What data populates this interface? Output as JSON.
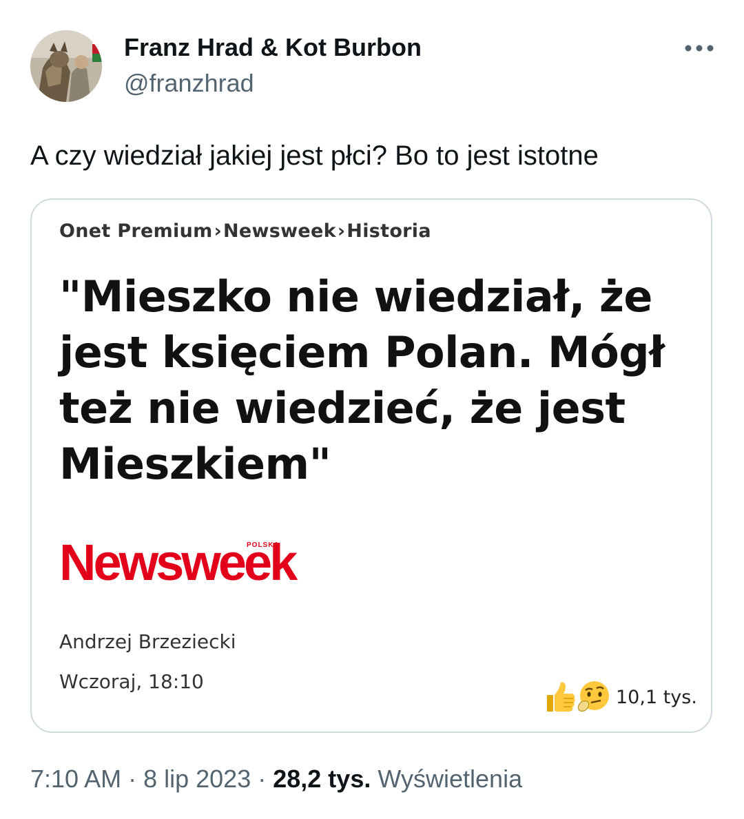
{
  "author": {
    "display_name": "Franz Hrad & Kot Burbon",
    "handle": "@franzhrad"
  },
  "tweet": {
    "text": "A czy wiedział jakiej jest płci? Bo to jest istotne",
    "time": "7:10 AM",
    "separator": "·",
    "date": "8 lip 2023",
    "views_count": "28,2 tys.",
    "views_label": "Wyświetlenia"
  },
  "media": {
    "breadcrumb": [
      "Onet Premium",
      "Newsweek",
      "Historia"
    ],
    "breadcrumb_separator": "›",
    "headline": "\"Mieszko nie wiedział, że jest księciem Polan. Mógł też nie wiedzieć, że jest Mieszkiem\"",
    "logo_text": "Newsweek",
    "logo_subtext": "POLSKA",
    "article_author": "Andrzej Brzeziecki",
    "article_date": "Wczoraj, 18:10",
    "reactions": {
      "icons": [
        "thumbs-up-icon",
        "thinking-face-icon"
      ],
      "count": "10,1 tys."
    }
  },
  "icons": {
    "more": "more-dots-icon"
  },
  "colors": {
    "text_primary": "#0f1419",
    "text_secondary": "#536471",
    "border": "#cfd9de",
    "newsweek_red": "#e2001a"
  }
}
